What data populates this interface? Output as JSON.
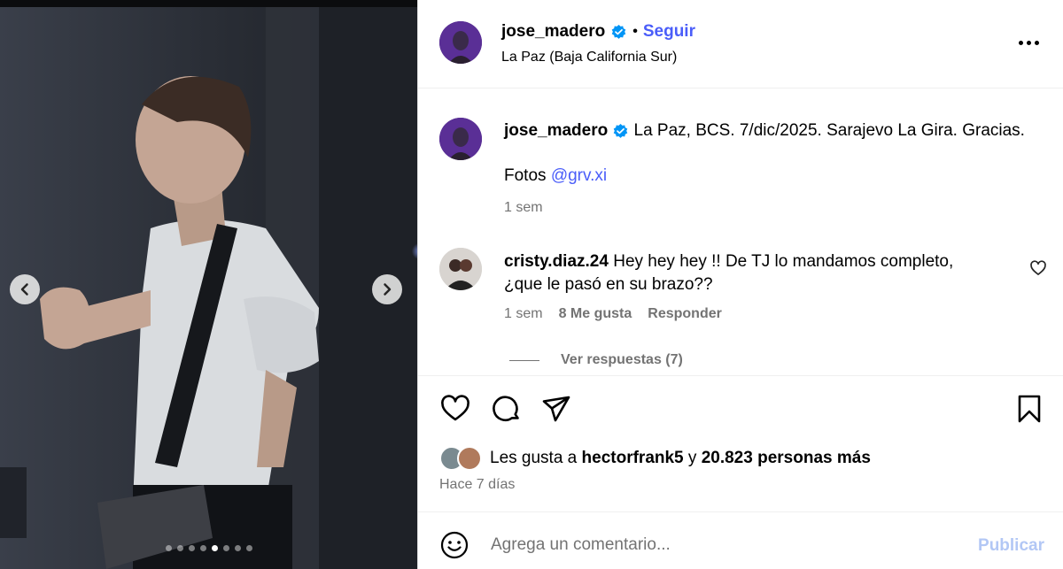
{
  "media": {
    "prev_icon": "chevron-left-icon",
    "next_icon": "chevron-right-icon",
    "dots_total": 8,
    "dots_active_index": 4
  },
  "header": {
    "username": "jose_madero",
    "verified_icon": "verified-badge-icon",
    "separator": "•",
    "follow_label": "Seguir",
    "location": "La Paz (Baja California Sur)",
    "more_icon": "more-options-icon"
  },
  "caption": {
    "username": "jose_madero",
    "text": "La Paz, BCS. 7/dic/2025. Sarajevo La Gira. Gracias.",
    "photos_label": "Fotos",
    "photos_handle": "@grv.xi",
    "time": "1 sem"
  },
  "comment": {
    "username": "cristy.diaz.24",
    "line1": "Hey hey hey !! De TJ lo mandamos completo,",
    "line2": "¿que le pasó en su brazo??",
    "time": "1 sem",
    "likes": "8 Me gusta",
    "reply_label": "Responder",
    "view_replies": "Ver respuestas (7)"
  },
  "actions": {
    "like_icon": "heart-icon",
    "comment_icon": "comment-icon",
    "share_icon": "share-icon",
    "save_icon": "bookmark-icon"
  },
  "likes": {
    "prefix": "Les gusta a",
    "user": "hectorfrank5",
    "connector": "y",
    "others": "20.823 personas más"
  },
  "post_age": "Hace 7 días",
  "composer": {
    "placeholder": "Agrega un comentario...",
    "publish_label": "Publicar",
    "emoji_icon": "emoji-icon"
  },
  "colors": {
    "link": "#4a5df9",
    "muted": "#737373",
    "publish_disabled": "#b2c7f5",
    "verified": "#0095f6"
  }
}
